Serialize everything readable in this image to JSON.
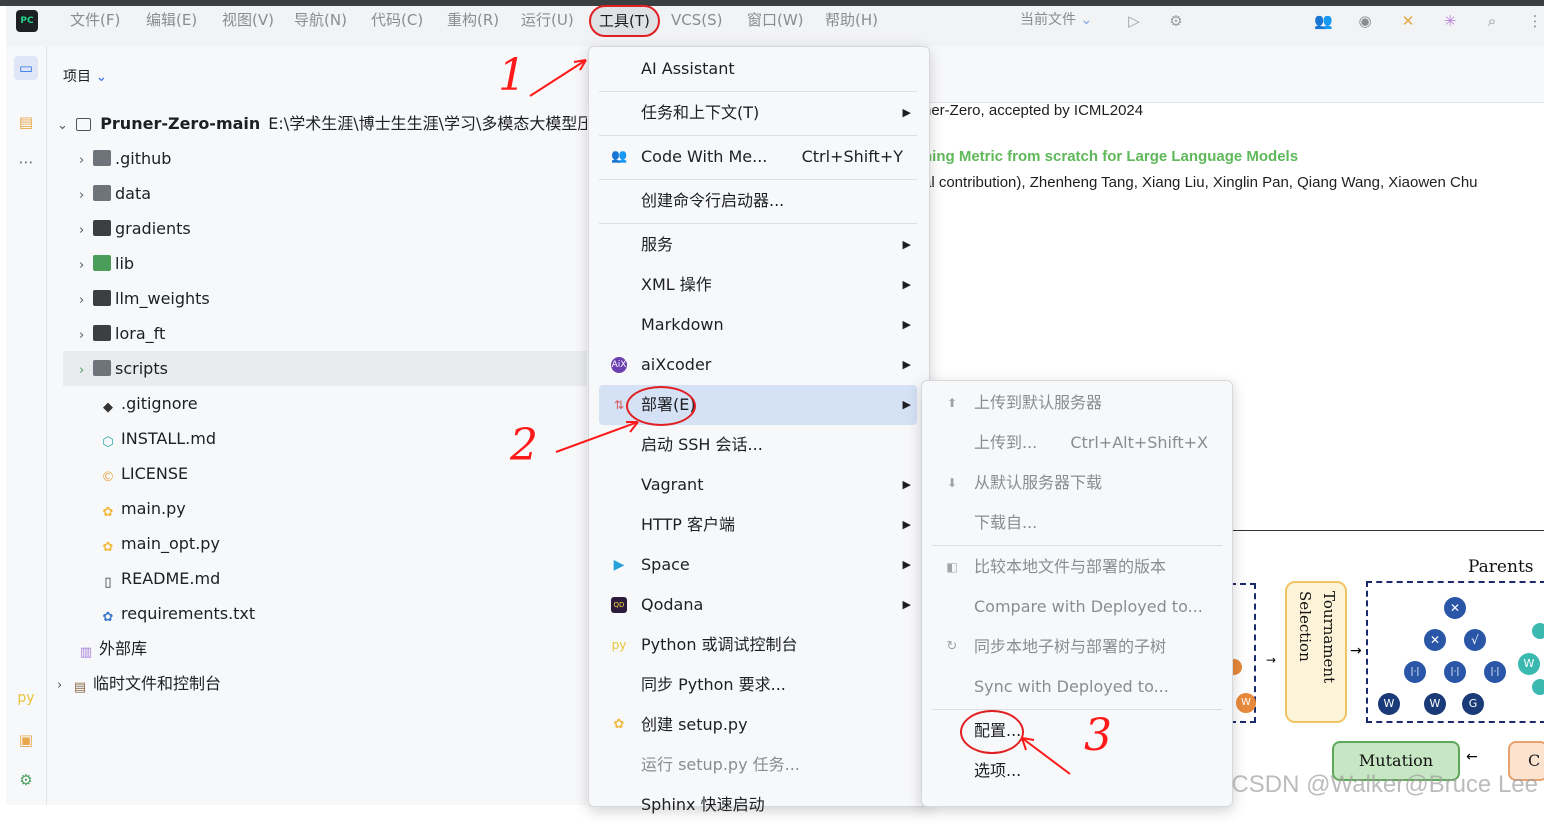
{
  "menubar": {
    "items": [
      "文件(F)",
      "编辑(E)",
      "视图(V)",
      "导航(N)",
      "代码(C)",
      "重构(R)",
      "运行(U)",
      "工具(T)",
      "VCS(S)",
      "窗口(W)",
      "帮助(H)"
    ],
    "current_file": "当前文件"
  },
  "project": {
    "header": "项目",
    "root_name": "Pruner-Zero-main",
    "root_path": "E:\\学术生涯\\博士生生涯\\学习\\多模态大模型压",
    "items": [
      ".github",
      "data",
      "gradients",
      "lib",
      "llm_weights",
      "lora_ft",
      "scripts",
      ".gitignore",
      "INSTALL.md",
      "LICENSE",
      "main.py",
      "main_opt.py",
      "README.md",
      "requirements.txt"
    ],
    "external_libs": "外部库",
    "scratches": "临时文件和控制台"
  },
  "editor": {
    "line1": "ner-Zero, accepted by ICML2024",
    "line2": "ning Metric from scratch for Large Language Models",
    "line3": "al contribution), Zhenheng Tang, Xiang Liu, Xinglin Pan, Qiang Wang, Xiaowen Chu"
  },
  "diagram": {
    "parents": "Parents",
    "tournament": "Tournament Selection",
    "mutation": "Mutation",
    "c_partial": "C"
  },
  "tools_menu": {
    "ai_assistant": "AI Assistant",
    "tasks": "任务和上下文(T)",
    "code_with_me": "Code With Me...",
    "code_with_me_shortcut": "Ctrl+Shift+Y",
    "cmd_launcher": "创建命令行启动器...",
    "services": "服务",
    "xml": "XML 操作",
    "markdown": "Markdown",
    "aixcoder": "aiXcoder",
    "deploy": "部署(E)",
    "ssh": "启动 SSH 会话...",
    "vagrant": "Vagrant",
    "http": "HTTP 客户端",
    "space": "Space",
    "qodana": "Qodana",
    "python_console": "Python 或调试控制台",
    "sync_python": "同步 Python 要求...",
    "setup_py": "创建 setup.py",
    "run_setup": "运行 setup.py 任务...",
    "sphinx": "Sphinx 快速启动"
  },
  "deploy_menu": {
    "upload_default": "上传到默认服务器",
    "upload_to": "上传到...",
    "upload_to_shortcut": "Ctrl+Alt+Shift+X",
    "download_default": "从默认服务器下载",
    "download_from": "下载自...",
    "compare": "比较本地文件与部署的版本",
    "compare_deployed": "Compare with Deployed to...",
    "sync_subtree": "同步本地子树与部署的子树",
    "sync_deployed": "Sync with Deployed to...",
    "config": "配置...",
    "options": "选项..."
  },
  "annotations": {
    "n1": "1",
    "n2": "2",
    "n3": "3"
  },
  "watermark": "CSDN @Walker@Bruce Lee"
}
